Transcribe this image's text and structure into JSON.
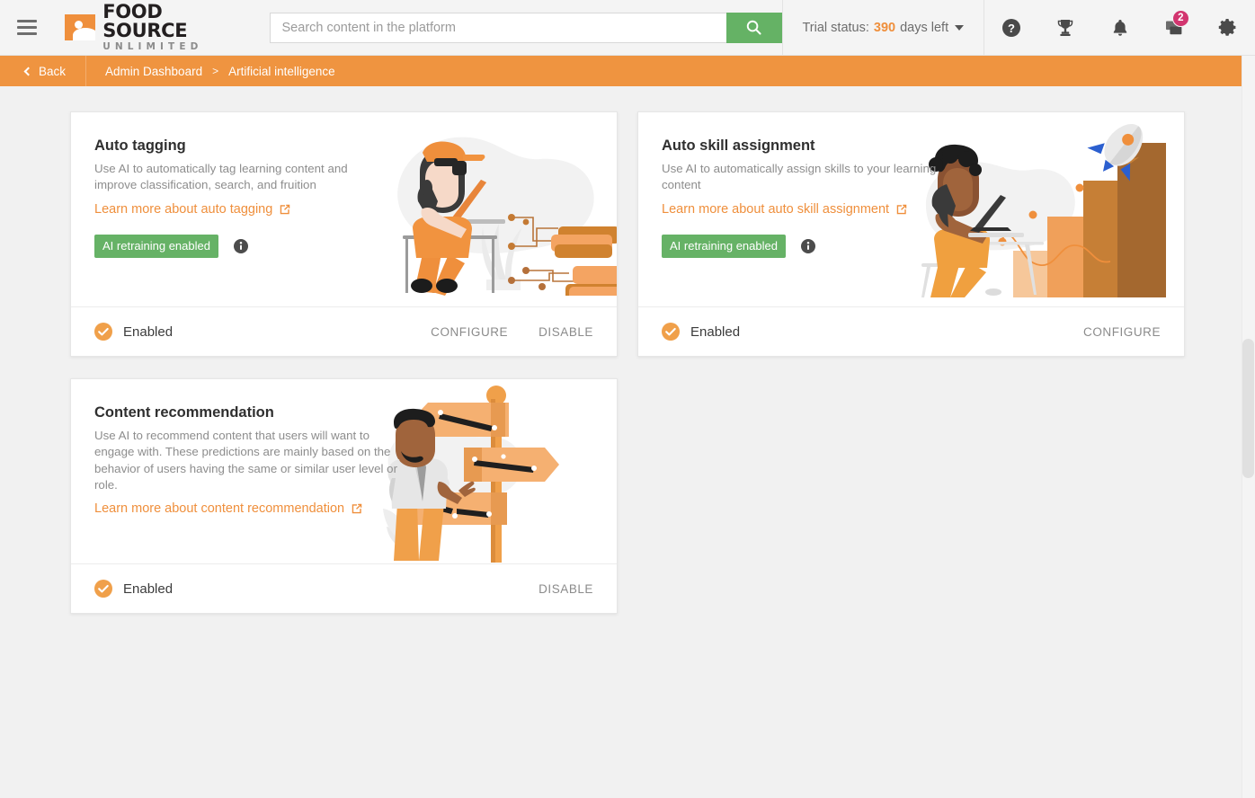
{
  "header": {
    "menu_label": "menu",
    "logo": {
      "line1": "FOOD SOURCE",
      "line2": "UNLIMITED"
    },
    "search": {
      "placeholder": "Search content in the platform",
      "value": "",
      "button_icon": "search-icon"
    },
    "trial": {
      "prefix": "Trial status:",
      "days": "390",
      "suffix": "days left"
    },
    "icons": {
      "help": "help-icon",
      "trophy": "trophy-icon",
      "bell": "bell-icon",
      "messages": "chat-icon",
      "messages_badge": "2",
      "settings": "gear-icon"
    }
  },
  "breadcrumb": {
    "back_label": "Back",
    "items": [
      {
        "label": "Admin Dashboard"
      },
      {
        "label": "Artificial intelligence"
      }
    ],
    "separator": ">"
  },
  "cards": [
    {
      "title": "Auto tagging",
      "description": "Use AI to automatically tag learning content and improve classification, search, and fruition",
      "learn_more": "Learn more about auto tagging",
      "retraining_badge": "AI retraining enabled",
      "status": "Enabled",
      "actions": [
        "CONFIGURE",
        "DISABLE"
      ],
      "illustration": "person-laptop-tags-illustration"
    },
    {
      "title": "Auto skill assignment",
      "description": "Use AI to automatically assign skills to your learning content",
      "learn_more": "Learn more about auto skill assignment",
      "retraining_badge": "AI retraining enabled",
      "status": "Enabled",
      "actions": [
        "CONFIGURE"
      ],
      "illustration": "person-growth-chart-rocket-illustration"
    },
    {
      "title": "Content recommendation",
      "description": "Use AI to recommend content that users will want to engage with. These predictions are mainly based on the behavior of users having the same or similar user level or role.",
      "learn_more": "Learn more about content recommendation",
      "retraining_badge": null,
      "status": "Enabled",
      "actions": [
        "DISABLE"
      ],
      "illustration": "person-signpost-illustration"
    }
  ],
  "colors": {
    "brand_orange": "#ef8f3c",
    "breadcrumb_orange": "#ef9440",
    "green": "#66b266",
    "search_green": "#65b265",
    "badge_pink": "#d2356f",
    "page_bg": "#f1f1f1"
  }
}
